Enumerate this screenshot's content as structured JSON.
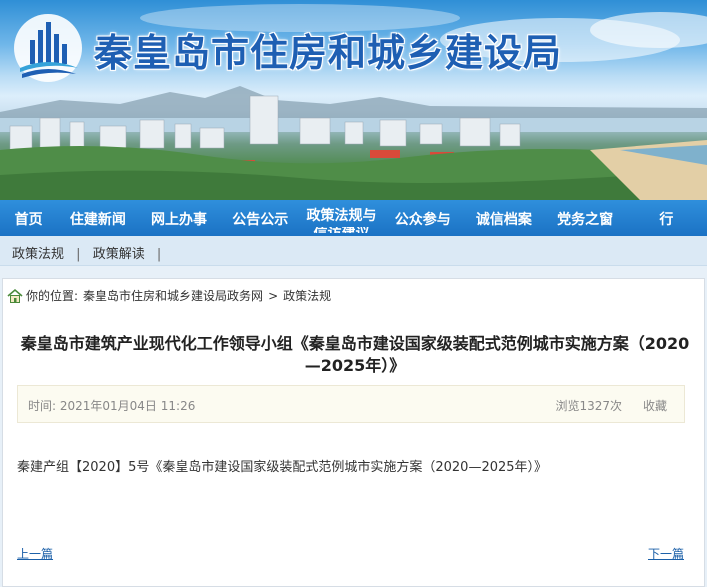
{
  "banner": {
    "title": "秦皇岛市住房和城乡建设局"
  },
  "nav": {
    "items": [
      {
        "label": "首页"
      },
      {
        "label": "住建新闻"
      },
      {
        "label": "网上办事"
      },
      {
        "label": "公告公示"
      },
      {
        "label": "政策法规与",
        "sub": "信访建议"
      },
      {
        "label": "公众参与"
      },
      {
        "label": "诚信档案"
      },
      {
        "label": "党务之窗"
      },
      {
        "label": "行"
      }
    ]
  },
  "subnav": {
    "items": [
      {
        "label": "政策法规"
      },
      {
        "label": "政策解读"
      }
    ],
    "separator": "|"
  },
  "breadcrumb": {
    "prefix": "你的位置:",
    "items": [
      "秦皇岛市住房和城乡建设局政务网",
      "政策法规"
    ],
    "separator": ">"
  },
  "article": {
    "title": "秦皇岛市建筑产业现代化工作领导小组《秦皇岛市建设国家级装配式范例城市实施方案（2020—2025年）》",
    "time_label": "时间: 2021年01月04日 11:26",
    "views": "浏览1327次",
    "favorite": "收藏",
    "body": "秦建产组【2020】5号《秦皇岛市建设国家级装配式范例城市实施方案（2020—2025年）》",
    "prev": "上一篇",
    "next": "下一篇"
  },
  "colors": {
    "nav_bg": "#1b72c4",
    "title_blue": "#1e5fb3",
    "link_blue": "#1a5fa8"
  }
}
